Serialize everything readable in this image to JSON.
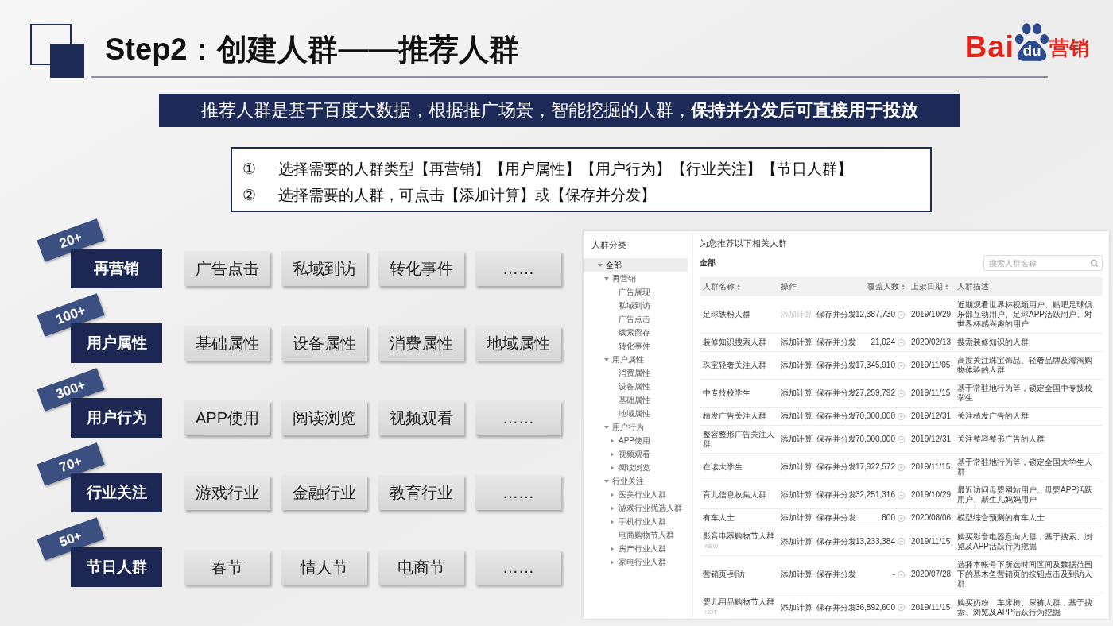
{
  "header": {
    "title": "Step2：创建人群——推荐人群",
    "logo": {
      "latin": "Bai",
      "paw": "du",
      "chinese": "营销"
    }
  },
  "banner": {
    "text": "推荐人群是基于百度大数据，根据推广场景，智能挖掘的人群，**保持并分发后可直接用于投放**"
  },
  "instructions": [
    {
      "marker": "①",
      "text": "选择需要的人群类型【再营销】【用户属性】【用户行为】【行业关注】【节日人群】"
    },
    {
      "marker": "②",
      "text": "选择需要的人群，可点击【添加计算】或【保存并分发】"
    }
  ],
  "categories": [
    {
      "count": "20+",
      "name": "再营销",
      "items": [
        "广告点击",
        "私域到访",
        "转化事件",
        "……"
      ]
    },
    {
      "count": "100+",
      "name": "用户属性",
      "items": [
        "基础属性",
        "设备属性",
        "消费属性",
        "地域属性"
      ]
    },
    {
      "count": "300+",
      "name": "用户行为",
      "items": [
        "APP使用",
        "阅读浏览",
        "视频观看",
        "……"
      ]
    },
    {
      "count": "70+",
      "name": "行业关注",
      "items": [
        "游戏行业",
        "金融行业",
        "教育行业",
        "……"
      ]
    },
    {
      "count": "50+",
      "name": "节日人群",
      "items": [
        "春节",
        "情人节",
        "电商节",
        "……"
      ]
    }
  ],
  "app_screenshot": {
    "sidebar": {
      "title": "人群分类",
      "tree": [
        {
          "label": "全部",
          "expanded": true,
          "selected": true,
          "children": [
            {
              "label": "再营销",
              "expanded": true,
              "selected": false,
              "children": [
                {
                  "label": "广告展现",
                  "selected": false
                },
                {
                  "label": "私域到访",
                  "selected": false
                },
                {
                  "label": "广告点击",
                  "selected": false
                },
                {
                  "label": "线索留存",
                  "selected": false
                },
                {
                  "label": "转化事件",
                  "selected": false
                }
              ]
            },
            {
              "label": "用户属性",
              "expanded": true,
              "selected": false,
              "children": [
                {
                  "label": "消费属性",
                  "selected": false
                },
                {
                  "label": "设备属性",
                  "selected": false
                },
                {
                  "label": "基础属性",
                  "selected": false
                },
                {
                  "label": "地域属性",
                  "selected": false
                }
              ]
            },
            {
              "label": "用户行为",
              "expanded": true,
              "selected": false,
              "children": [
                {
                  "label": "APP使用",
                  "expanded": false,
                  "selected": false
                },
                {
                  "label": "视频观看",
                  "expanded": false,
                  "selected": false
                },
                {
                  "label": "阅读浏览",
                  "expanded": false,
                  "selected": false
                }
              ]
            },
            {
              "label": "行业关注",
              "expanded": true,
              "selected": false,
              "children": [
                {
                  "label": "医美行业人群",
                  "expanded": false,
                  "selected": false
                },
                {
                  "label": "游戏行业优选人群",
                  "expanded": false,
                  "selected": false
                },
                {
                  "label": "手机行业人群",
                  "expanded": false,
                  "selected": false
                },
                {
                  "label": "电商购物节人群",
                  "selected": false
                },
                {
                  "label": "房产行业人群",
                  "expanded": false,
                  "selected": false
                },
                {
                  "label": "家电行业人群",
                  "expanded": false,
                  "selected": false
                }
              ]
            }
          ]
        }
      ]
    },
    "main": {
      "heading": "为您推荐以下相关人群",
      "filter": "全部",
      "search": {
        "placeholder": "搜索人群名称"
      },
      "table": {
        "columns": [
          {
            "label": "人群名称",
            "sortable": true
          },
          {
            "label": "操作",
            "sortable": false
          },
          {
            "label": "覆盖人数",
            "sortable": true
          },
          {
            "label": "上架日期",
            "sortable": true
          },
          {
            "label": "人群描述",
            "sortable": false
          }
        ],
        "rows": [
          {
            "name": "足球铁粉人群",
            "actions": [
              {
                "label": "添加计算",
                "disabled": true
              },
              {
                "label": "保存并分发",
                "disabled": false
              }
            ],
            "coverage": "12,387,730",
            "date": "2019/10/29",
            "description": "近期观看世界杯视频用户、贴吧足球俱乐部互动用户、足球APP活跃用户、对世界杯感兴趣的用户"
          },
          {
            "name": "装修知识搜索人群",
            "actions": [
              {
                "label": "添加计算",
                "disabled": false
              },
              {
                "label": "保存并分发",
                "disabled": false
              }
            ],
            "coverage": "21,024",
            "date": "2020/02/13",
            "description": "搜索装修知识的人群"
          },
          {
            "name": "珠宝轻奢关注人群",
            "actions": [
              {
                "label": "添加计算",
                "disabled": false
              },
              {
                "label": "保存并分发",
                "disabled": false
              }
            ],
            "coverage": "17,345,910",
            "date": "2019/11/05",
            "description": "高度关注珠宝饰品、轻奢品牌及海淘购物体验的人群"
          },
          {
            "name": "中专技校学生",
            "actions": [
              {
                "label": "添加计算",
                "disabled": false
              },
              {
                "label": "保存并分发",
                "disabled": false
              }
            ],
            "coverage": "27,259,792",
            "date": "2019/11/15",
            "description": "基于常驻地行为等，锁定全国中专技校学生"
          },
          {
            "name": "植发广告关注人群",
            "actions": [
              {
                "label": "添加计算",
                "disabled": false
              },
              {
                "label": "保存并分发",
                "disabled": false
              }
            ],
            "coverage": "70,000,000",
            "date": "2019/12/31",
            "description": "关注植发广告的人群"
          },
          {
            "name": "整容整形广告关注人群",
            "actions": [
              {
                "label": "添加计算",
                "disabled": false
              },
              {
                "label": "保存并分发",
                "disabled": false
              }
            ],
            "coverage": "70,000,000",
            "date": "2019/12/31",
            "description": "关注整容整形广告的人群"
          },
          {
            "name": "在读大学生",
            "actions": [
              {
                "label": "添加计算",
                "disabled": false
              },
              {
                "label": "保存并分发",
                "disabled": false
              }
            ],
            "coverage": "17,922,572",
            "date": "2019/11/15",
            "description": "基于常驻地行为等，锁定全国大学生人群"
          },
          {
            "name": "育儿信息收集人群",
            "actions": [
              {
                "label": "添加计算",
                "disabled": false
              },
              {
                "label": "保存并分发",
                "disabled": false
              }
            ],
            "coverage": "32,251,316",
            "date": "2019/10/29",
            "description": "最近访问母婴网站用户、母婴APP活跃用户、新生儿妈妈用户"
          },
          {
            "name": "有车人士",
            "actions": [
              {
                "label": "添加计算",
                "disabled": false
              },
              {
                "label": "保存并分发",
                "disabled": false
              }
            ],
            "coverage": "800",
            "date": "2020/08/06",
            "description": "模型综合预测的有车人士"
          },
          {
            "name": "影音电器购物节人群",
            "tag": "NEW",
            "actions": [
              {
                "label": "添加计算",
                "disabled": false
              },
              {
                "label": "保存并分发",
                "disabled": false
              }
            ],
            "coverage": "13,233,384",
            "date": "2019/11/15",
            "description": "购买影音电器意向人群，基于搜索、浏览及APP活跃行为挖掘"
          },
          {
            "name": "营销页-到访",
            "actions": [
              {
                "label": "添加计算",
                "disabled": false
              },
              {
                "label": "保存并分发",
                "disabled": false
              }
            ],
            "coverage": "-",
            "date": "2020/07/28",
            "description": "选择本帐号下所选时间区间及数据范围下的基木鱼营销页的按钮点击及到访人群"
          },
          {
            "name": "婴儿用品购物节人群",
            "tag": "HOT",
            "actions": [
              {
                "label": "添加计算",
                "disabled": false
              },
              {
                "label": "保存并分发",
                "disabled": false
              }
            ],
            "coverage": "36,892,600",
            "date": "2019/11/15",
            "description": "购买奶粉、车床椅、尿裤人群，基于搜索、浏览及APP活跃行为挖掘"
          }
        ]
      }
    }
  }
}
